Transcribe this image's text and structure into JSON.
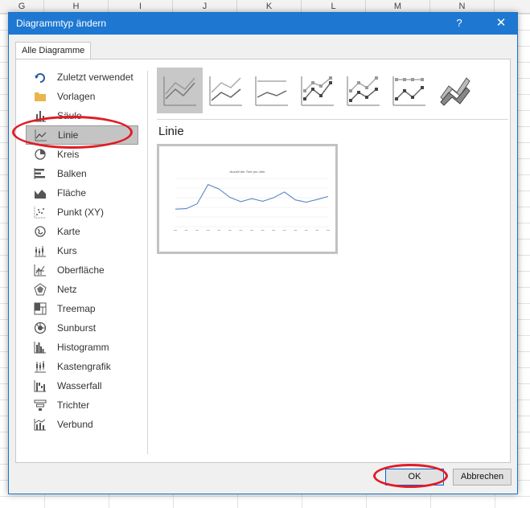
{
  "spreadsheet": {
    "columns": [
      "G",
      "H",
      "I",
      "J",
      "K",
      "L",
      "M",
      "N"
    ]
  },
  "dialog": {
    "title": "Diagrammtyp ändern",
    "help_label": "?",
    "close_label": "✕",
    "tab_label": "Alle Diagramme",
    "categories": [
      {
        "label": "Zuletzt verwendet",
        "icon": "recent-icon"
      },
      {
        "label": "Vorlagen",
        "icon": "folder-icon"
      },
      {
        "label": "Säule",
        "icon": "column-chart-icon"
      },
      {
        "label": "Linie",
        "icon": "line-chart-icon"
      },
      {
        "label": "Kreis",
        "icon": "pie-chart-icon"
      },
      {
        "label": "Balken",
        "icon": "bar-chart-icon"
      },
      {
        "label": "Fläche",
        "icon": "area-chart-icon"
      },
      {
        "label": "Punkt (XY)",
        "icon": "scatter-chart-icon"
      },
      {
        "label": "Karte",
        "icon": "map-chart-icon"
      },
      {
        "label": "Kurs",
        "icon": "stock-chart-icon"
      },
      {
        "label": "Oberfläche",
        "icon": "surface-chart-icon"
      },
      {
        "label": "Netz",
        "icon": "radar-chart-icon"
      },
      {
        "label": "Treemap",
        "icon": "treemap-icon"
      },
      {
        "label": "Sunburst",
        "icon": "sunburst-icon"
      },
      {
        "label": "Histogramm",
        "icon": "histogram-icon"
      },
      {
        "label": "Kastengrafik",
        "icon": "box-whisker-icon"
      },
      {
        "label": "Wasserfall",
        "icon": "waterfall-icon"
      },
      {
        "label": "Trichter",
        "icon": "funnel-icon"
      },
      {
        "label": "Verbund",
        "icon": "combo-chart-icon"
      }
    ],
    "selected_category": "Linie",
    "subtype_heading": "Linie",
    "subtypes": [
      {
        "icon": "line-subtype-icon",
        "selected": true
      },
      {
        "icon": "stacked-line-subtype-icon",
        "selected": false
      },
      {
        "icon": "stacked-100-line-subtype-icon",
        "selected": false
      },
      {
        "icon": "line-markers-subtype-icon",
        "selected": false
      },
      {
        "icon": "stacked-line-markers-subtype-icon",
        "selected": false
      },
      {
        "icon": "stacked-100-line-markers-subtype-icon",
        "selected": false
      },
      {
        "icon": "3d-line-subtype-icon",
        "selected": false
      }
    ],
    "ok_label": "OK",
    "cancel_label": "Abbrechen"
  },
  "preview_chart": {
    "chart_data": {
      "type": "line",
      "title": "Anzahl der Tore pro Jahr",
      "values": [
        40,
        41,
        52,
        96,
        86,
        67,
        57,
        64,
        58,
        66,
        79,
        61,
        56,
        62,
        69
      ],
      "series_color": "#5b87c5"
    }
  },
  "colors": {
    "titlebar": "#1e78d2",
    "annotation": "#e01c26",
    "selected_bg": "#c4c4c4"
  }
}
